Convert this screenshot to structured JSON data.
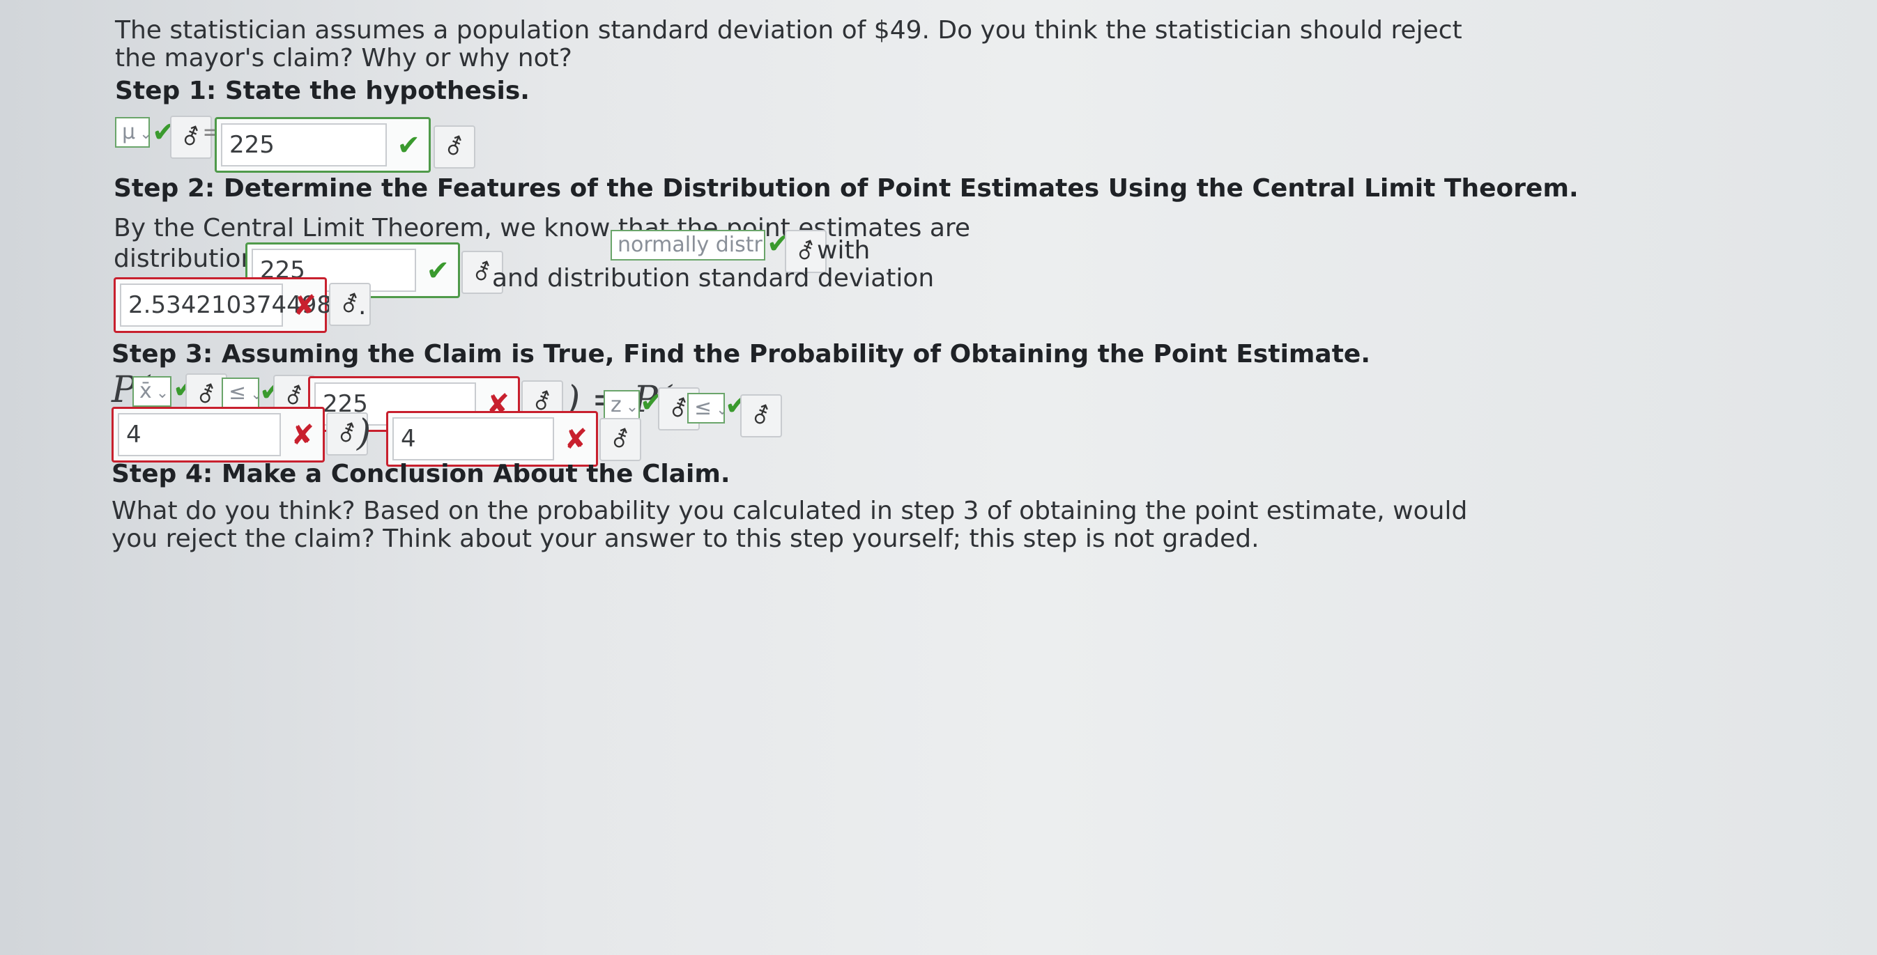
{
  "intro": {
    "line1": "The statistician assumes a population standard deviation of $49. Do you think the statistician should reject",
    "line2": "the mayor's claim? Why or why not?"
  },
  "step1": {
    "heading": "Step 1: State the hypothesis.",
    "param_select": "μ",
    "equals": "=",
    "value": "225"
  },
  "step2": {
    "heading": "Step 2: Determine the Features of the Distribution of Point Estimates Using the Central Limit Theorem.",
    "sentence_part1": "By the Central Limit Theorem, we know that the point estimates are",
    "dist_select": "normally distributed",
    "with": "with",
    "mean_label": "distribution mean",
    "mean_value": "225",
    "sd_label": "and distribution standard deviation",
    "sd_value": "2.534210374498",
    "period": "."
  },
  "step3": {
    "heading": "Step 3: Assuming the Claim is True, Find the Probability of Obtaining the Point Estimate.",
    "p_open": "P(",
    "var_select": "x̄",
    "ineq_select": "≤",
    "point_value": "225",
    "close_eq": ") = P(",
    "z_select": "z",
    "ineq2_select": "≤",
    "z_value": "4",
    "close_eq2": ") =",
    "prob_value": "4"
  },
  "step4": {
    "heading": "Step 4: Make a Conclusion About the Claim.",
    "line1": "What do you think? Based on the probability you calculated in step 3 of obtaining the point estimate, would",
    "line2": "you reject the claim? Think about your answer to this step yourself; this step is not graded."
  },
  "icons": {
    "check": "check-icon",
    "cross": "cross-icon",
    "tools": "math-tools-icon",
    "chevron": "chevron-down-icon"
  },
  "colors": {
    "correct": "#3a9a2e",
    "incorrect": "#c8202e"
  }
}
